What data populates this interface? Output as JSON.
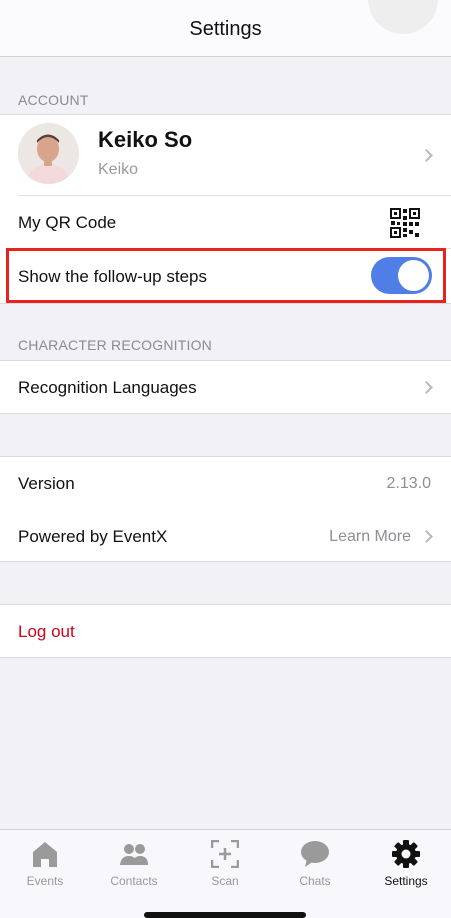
{
  "nav": {
    "title": "Settings"
  },
  "account": {
    "header": "ACCOUNT",
    "profile": {
      "name": "Keiko So",
      "username": "Keiko"
    },
    "qr_label": "My QR Code",
    "followup_label": "Show the follow-up steps",
    "followup_enabled": true
  },
  "recognition": {
    "header": "CHARACTER RECOGNITION",
    "languages_label": "Recognition Languages"
  },
  "about": {
    "version_label": "Version",
    "version_value": "2.13.0",
    "powered_label": "Powered by EventX",
    "learn_more": "Learn More"
  },
  "logout_label": "Log out",
  "tabs": [
    {
      "label": "Events",
      "icon": "home-icon"
    },
    {
      "label": "Contacts",
      "icon": "contacts-icon"
    },
    {
      "label": "Scan",
      "icon": "scan-icon"
    },
    {
      "label": "Chats",
      "icon": "chat-icon"
    },
    {
      "label": "Settings",
      "icon": "gear-icon",
      "active": true
    }
  ],
  "colors": {
    "accent": "#4f7ee6",
    "logout": "#d0021b",
    "highlight": "#e8231d"
  }
}
